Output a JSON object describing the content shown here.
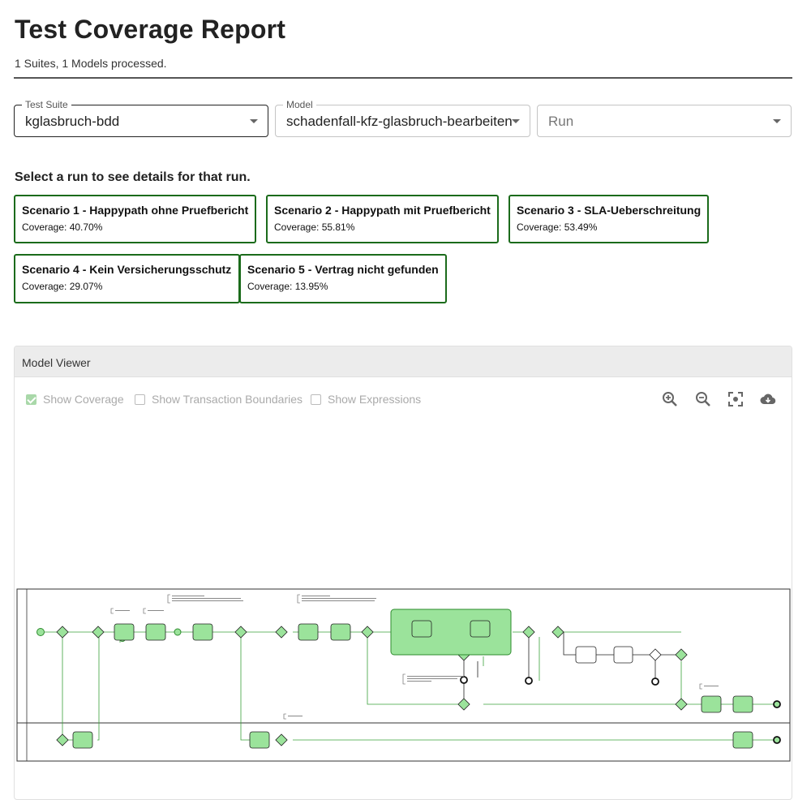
{
  "header": {
    "title": "Test Coverage Report",
    "subtitle": "1 Suites, 1 Models processed."
  },
  "selects": {
    "suite": {
      "label": "Test Suite",
      "value": "kglasbruch-bdd"
    },
    "model": {
      "label": "Model",
      "value": "schadenfall-kfz-glasbruch-bearbeiten"
    },
    "run": {
      "placeholder": "Run"
    }
  },
  "hint": "Select a run to see details for that run.",
  "runs": [
    {
      "name": "Scenario 1 - Happypath ohne Pruefbericht",
      "coverage": "Coverage: 40.70%"
    },
    {
      "name": "Scenario 2 - Happypath mit Pruefbericht",
      "coverage": "Coverage: 55.81%"
    },
    {
      "name": "Scenario 3 - SLA-Ueberschreitung",
      "coverage": "Coverage: 53.49%"
    },
    {
      "name": "Scenario 4 - Kein Versicherungsschutz",
      "coverage": "Coverage: 29.07%"
    },
    {
      "name": "Scenario 5 - Vertrag nicht gefunden",
      "coverage": "Coverage: 13.95%"
    }
  ],
  "viewer": {
    "title": "Model Viewer",
    "options": {
      "show_coverage": "Show Coverage",
      "show_transaction_boundaries": "Show Transaction Boundaries",
      "show_expressions": "Show Expressions"
    },
    "tools": [
      "zoom-in-icon",
      "zoom-out-icon",
      "fit-screen-icon",
      "download-icon"
    ]
  },
  "colors": {
    "accent_border": "#1b6b1b",
    "covered_fill": "#9be39b",
    "covered_stroke": "#2e8b2e",
    "uncovered": "#222222"
  }
}
